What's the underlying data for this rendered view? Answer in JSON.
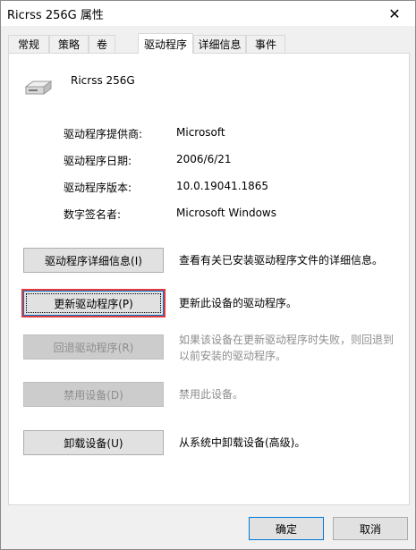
{
  "window": {
    "title": "Ricrss 256G 属性",
    "close_glyph": "✕"
  },
  "tabs": [
    {
      "label": "常规"
    },
    {
      "label": "策略"
    },
    {
      "label": "卷"
    },
    {
      "label": "驱动程序"
    },
    {
      "label": "详细信息"
    },
    {
      "label": "事件"
    }
  ],
  "active_tab": "驱动程序",
  "device": {
    "name": "Ricrss 256G",
    "icon": "drive-icon"
  },
  "info": [
    {
      "label": "驱动程序提供商:",
      "value": "Microsoft"
    },
    {
      "label": "驱动程序日期:",
      "value": "2006/6/21"
    },
    {
      "label": "驱动程序版本:",
      "value": "10.0.19041.1865"
    },
    {
      "label": "数字签名者:",
      "value": "Microsoft Windows"
    }
  ],
  "actions": [
    {
      "label": "驱动程序详细信息(I)",
      "desc": "查看有关已安装驱动程序文件的详细信息。",
      "enabled": true
    },
    {
      "label": "更新驱动程序(P)",
      "desc": "更新此设备的驱动程序。",
      "enabled": true,
      "focused": true
    },
    {
      "label": "回退驱动程序(R)",
      "desc": "如果该设备在更新驱动程序时失败，则回退到以前安装的驱动程序。",
      "enabled": false
    },
    {
      "label": "禁用设备(D)",
      "desc": "禁用此设备。",
      "enabled": false
    },
    {
      "label": "卸载设备(U)",
      "desc": "从系统中卸载设备(高级)。",
      "enabled": true
    }
  ],
  "footer": {
    "ok": "确定",
    "cancel": "取消"
  },
  "colors": {
    "focus_highlight": "#e03a3a",
    "accent": "#0078d7"
  }
}
